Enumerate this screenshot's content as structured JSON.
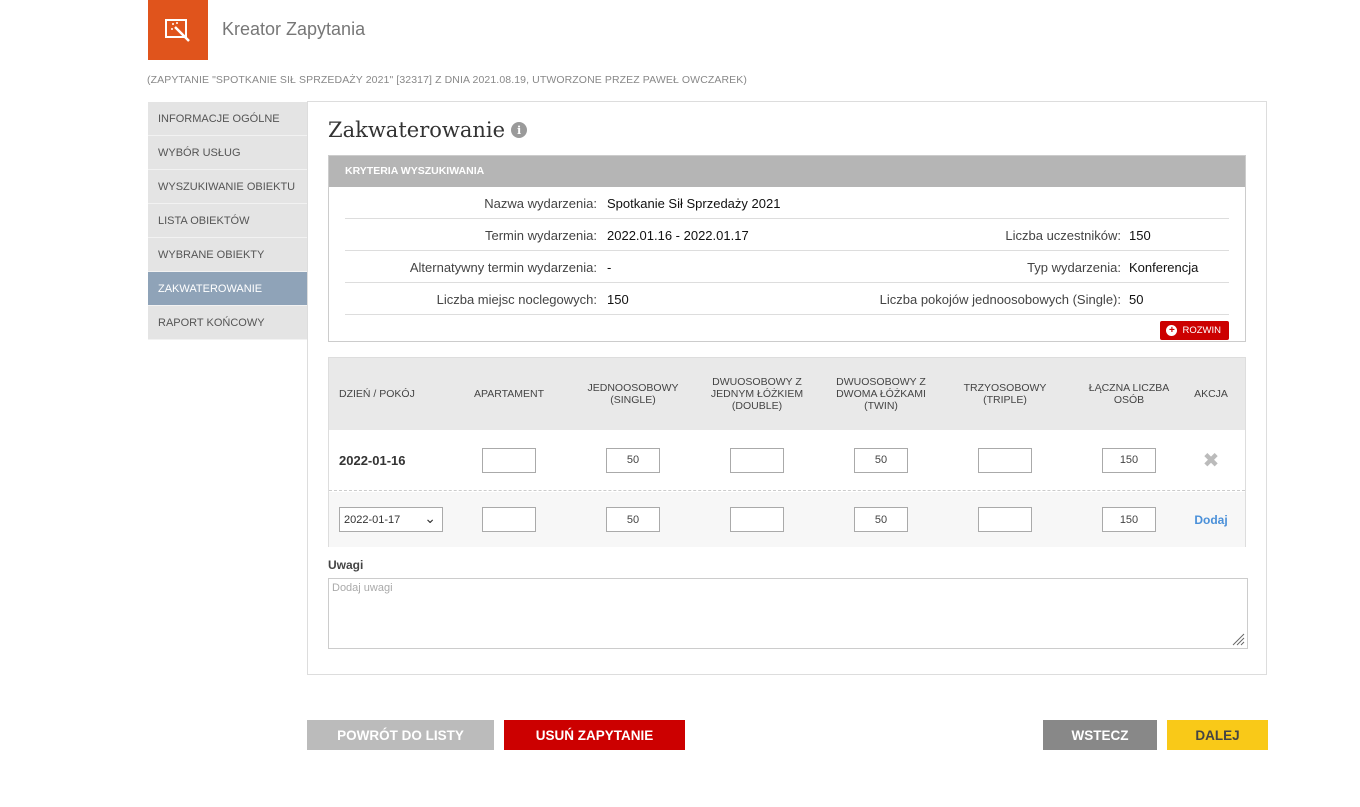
{
  "app": {
    "title": "Kreator Zapytania",
    "icon": "magic-wand-icon",
    "accent_color": "#e0541c"
  },
  "subtitle": "(ZAPYTANIE \"SPOTKANIE SIŁ SPRZEDAŻY 2021\" [32317] Z DNIA 2021.08.19, UTWORZONE PRZEZ PAWEŁ OWCZAREK)",
  "sidebar": {
    "items": [
      {
        "label": "INFORMACJE OGÓLNE"
      },
      {
        "label": "WYBÓR USŁUG"
      },
      {
        "label": "WYSZUKIWANIE OBIEKTU"
      },
      {
        "label": "LISTA OBIEKTÓW"
      },
      {
        "label": "WYBRANE OBIEKTY"
      },
      {
        "label": "ZAKWATEROWANIE"
      },
      {
        "label": "RAPORT KOŃCOWY"
      }
    ],
    "active_label": "ZAKWATEROWANIE",
    "active_color": "#8fa3b8"
  },
  "section": {
    "title": "Zakwaterowanie",
    "info_icon_glyph": "i"
  },
  "criteria": {
    "header": "KRYTERIA WYSZUKIWANIA",
    "rows": [
      {
        "label": "Nazwa wydarzenia:",
        "value": "Spotkanie Sił Sprzedaży 2021"
      },
      {
        "label": "Termin wydarzenia:",
        "value": "2022.01.16 - 2022.01.17",
        "label2": "Liczba uczestników:",
        "value2": "150"
      },
      {
        "label": "Alternatywny termin wydarzenia:",
        "value": "-",
        "label2": "Typ wydarzenia:",
        "value2": "Konferencja"
      },
      {
        "label": "Liczba miejsc noclegowych:",
        "value": "150",
        "label2": "Liczba pokojów jednoosobowych (Single):",
        "value2": "50"
      }
    ],
    "expand_label": "ROZWIN",
    "expand_glyph": "+"
  },
  "rooms": {
    "headers": {
      "day": "DZIEŃ / POKÓJ",
      "apartment": "APARTAMENT",
      "single": "JEDNOOSOBOWY\n(SINGLE)",
      "double": "DWUOSOBOWY Z\nJEDNYM ŁÓŻKIEM\n(DOUBLE)",
      "twin": "DWUOSOBOWY Z\nDWOMA ŁÓŻKAMI\n(TWIN)",
      "triple": "TRZYOSOBOWY\n(TRIPLE)",
      "total": "ŁĄCZNA LICZBA\nOSÓB",
      "action": "AKCJA"
    },
    "row1": {
      "date": "2022-01-16",
      "apartment": "",
      "single": "50",
      "double": "",
      "twin": "50",
      "triple": "",
      "total": "150",
      "action_glyph": "✖"
    },
    "row2": {
      "date_selected": "2022-01-17",
      "select_glyph": "⌄",
      "apartment": "",
      "single": "50",
      "double": "",
      "twin": "50",
      "triple": "",
      "total": "150",
      "add_label": "Dodaj"
    }
  },
  "notes": {
    "label": "Uwagi",
    "placeholder": "Dodaj uwagi"
  },
  "buttons": {
    "back_to_list": "POWRÓT DO LISTY",
    "delete_request": "USUŃ ZAPYTANIE",
    "previous": "WSTECZ",
    "next": "DALEJ"
  }
}
